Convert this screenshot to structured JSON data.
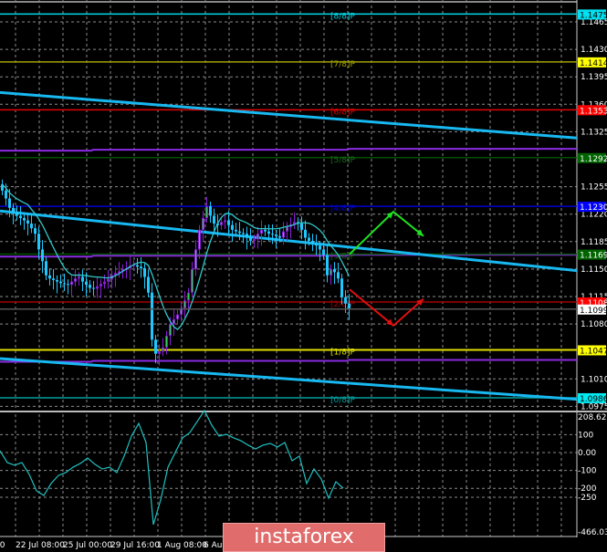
{
  "chart_data": {
    "type": "candlestick",
    "symbol_timeframe": "EUR/USD H4",
    "price_axis": {
      "ticks": [
        "1.1465",
        "1.1430",
        "1.1395",
        "1.1360",
        "1.1325",
        "1.1255",
        "1.1220",
        "1.1185",
        "1.1150",
        "1.1115",
        "1.1080",
        "1.1010",
        "1.0975"
      ],
      "range": [
        1.0955,
        1.1485
      ]
    },
    "time_axis": {
      "ticks": [
        "00",
        "22 Jul 08:00",
        "25 Jul 00:00",
        "29 Jul 16:00",
        "1 Aug 08:00",
        "6 Aug"
      ]
    },
    "closes": [
      1.125,
      1.124,
      1.1228,
      1.1222,
      1.1218,
      1.1215,
      1.1212,
      1.1208,
      1.1202,
      1.1195,
      1.1175,
      1.116,
      1.1142,
      1.1138,
      1.1136,
      1.1134,
      1.1132,
      1.1131,
      1.113,
      1.1134,
      1.1138,
      1.114,
      1.1134,
      1.113,
      1.1126,
      1.1125,
      1.1128,
      1.1131,
      1.1134,
      1.1137,
      1.1142,
      1.1145,
      1.1147,
      1.115,
      1.1151,
      1.1154,
      1.1155,
      1.1153,
      1.1151,
      1.114,
      1.112,
      1.106,
      1.1042,
      1.1045,
      1.105,
      1.1065,
      1.108,
      1.1086,
      1.1092,
      1.11,
      1.111,
      1.112,
      1.115,
      1.1175,
      1.12,
      1.1215,
      1.123,
      1.1218,
      1.1208,
      1.1206,
      1.121,
      1.1212,
      1.1206,
      1.12,
      1.1198,
      1.1196,
      1.1195,
      1.119,
      1.1186,
      1.1188,
      1.1195,
      1.12,
      1.1198,
      1.1195,
      1.1194,
      1.1192,
      1.119,
      1.1198,
      1.1204,
      1.1207,
      1.121,
      1.1208,
      1.12,
      1.119,
      1.1186,
      1.1182,
      1.118,
      1.1175,
      1.1168,
      1.1142,
      1.115,
      1.1146,
      1.1138,
      1.1114,
      1.1106,
      1.11
    ],
    "moving_average_period": 8,
    "current_price": {
      "value": 1.1099,
      "label": "1.1099"
    },
    "murray_levels": [
      {
        "name": "[8/8]P",
        "value": 1.1475,
        "label": "1.1475",
        "color": "#00d8e8",
        "bg": "#00e0f0",
        "fg": "#000000"
      },
      {
        "name": "[7/8]P",
        "value": 1.1414,
        "label": "1.1414",
        "color": "#a0a000",
        "bg": "#ffff00",
        "fg": "#000000"
      },
      {
        "name": "[6/8]P",
        "value": 1.1353,
        "label": "1.1353",
        "color": "#e00000",
        "bg": "#ff0000",
        "fg": "#ffffff"
      },
      {
        "name": "[5/8]P",
        "value": 1.1292,
        "label": "1.1292",
        "color": "#005000",
        "bg": "#006400",
        "fg": "#ffffff"
      },
      {
        "name": "[4/8]P",
        "value": 1.123,
        "label": "1.1230",
        "color": "#0000d0",
        "bg": "#0000ff",
        "fg": "#ffffff"
      },
      {
        "name": "[3/8]P",
        "value": 1.1169,
        "label": "1.1169",
        "color": "#005000",
        "bg": "#006400",
        "fg": "#ffffff"
      },
      {
        "name": "[2/8]P",
        "value": 1.1108,
        "label": "1.1108",
        "color": "#a00000",
        "bg": "#ff0000",
        "fg": "#ffffff"
      },
      {
        "name": "[1/8]P",
        "value": 1.1047,
        "label": "1.1047",
        "color": "#e0e000",
        "bg": "#ffff00",
        "fg": "#000000"
      },
      {
        "name": "[0/8]P",
        "value": 1.0986,
        "label": "1.0986",
        "color": "#00a0a0",
        "bg": "#00e8f0",
        "fg": "#000000"
      }
    ],
    "purple_levels": [
      1.1302,
      1.1167,
      1.1033
    ],
    "trend_lines": [
      {
        "from": [
          0,
          1.1375
        ],
        "to": [
          1,
          1.1317
        ]
      },
      {
        "from": [
          0,
          1.1224
        ],
        "to": [
          1,
          1.1148
        ]
      },
      {
        "from": [
          0,
          1.1036
        ],
        "to": [
          1,
          1.0984
        ]
      }
    ],
    "forecast_up": [
      [
        1.1169
      ],
      [
        1.1223
      ],
      [
        1.1192
      ]
    ],
    "forecast_down": [
      [
        1.1124
      ],
      [
        1.1078
      ],
      [
        1.1112
      ]
    ],
    "cci": {
      "ticks": [
        "208.6236",
        "100",
        "0.00",
        "-100",
        "-200",
        "-250",
        "-466.038"
      ],
      "range": [
        -466.038,
        208.6236
      ],
      "values": [
        10,
        -56,
        -71,
        -56,
        -122,
        -214,
        -240,
        -173,
        -128,
        -112,
        -82,
        -61,
        -31,
        -66,
        -92,
        -82,
        -112,
        -20,
        92,
        163,
        56,
        -403,
        -265,
        -82,
        0,
        82,
        112,
        173,
        235,
        153,
        92,
        102,
        82,
        66,
        41,
        20,
        41,
        51,
        31,
        56,
        -46,
        -20,
        -173,
        -92,
        -148,
        -255,
        -163,
        -199
      ]
    },
    "colors": {
      "bear": "#1ec8ff",
      "bull": "#8a1ed8",
      "bull_inner": "#22e040",
      "ma": "#30c8c8",
      "trend": "#18b8f0",
      "purple": "#8a2be2",
      "cci": "#20c0c0",
      "grid": "#8a8a8a"
    }
  },
  "watermark": "instaforex"
}
